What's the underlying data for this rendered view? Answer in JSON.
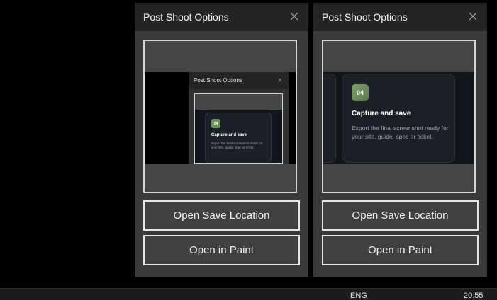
{
  "panels": [
    {
      "title": "Post Shoot Options",
      "buttons": {
        "save": "Open Save Location",
        "paint": "Open in Paint"
      },
      "preview": {
        "window_title": "Post Shoot Options",
        "card": {
          "badge": "04",
          "title": "Capture and save",
          "description": "Export the final screenshot ready for your site, guide, spec or ticket."
        }
      }
    },
    {
      "title": "Post Shoot Options",
      "buttons": {
        "save": "Open Save Location",
        "paint": "Open in Paint"
      },
      "preview": {
        "card": {
          "badge": "04",
          "title": "Capture and save",
          "description": "Export the final screenshot ready for your site, guide, spec or ticket."
        }
      }
    }
  ],
  "taskbar": {
    "language": "ENG",
    "time": "20:55"
  },
  "icons": {
    "close": "close-icon"
  },
  "colors": {
    "badge_green": "#6e8f5f",
    "panel_bg": "#3a3a3a",
    "titlebar_bg": "#242424"
  }
}
